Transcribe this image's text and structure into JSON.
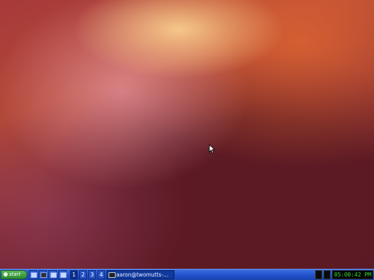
{
  "desktop": {
    "wallpaper": "ubuntu-warty-red-gradient"
  },
  "taskbar": {
    "start_label": "start",
    "quick_launch": [
      "window-icon",
      "terminal-icon",
      "monitor-icon",
      "window-icon"
    ],
    "workspaces": [
      "1",
      "2",
      "3",
      "4"
    ],
    "active_workspace": "1",
    "task_title": "aaron@twomutts-...",
    "clock": "05:00:42 PM"
  },
  "colors": {
    "taskbar": "#1f4fc8",
    "start": "#2e8b2e",
    "clock_text": "#33dd33"
  }
}
